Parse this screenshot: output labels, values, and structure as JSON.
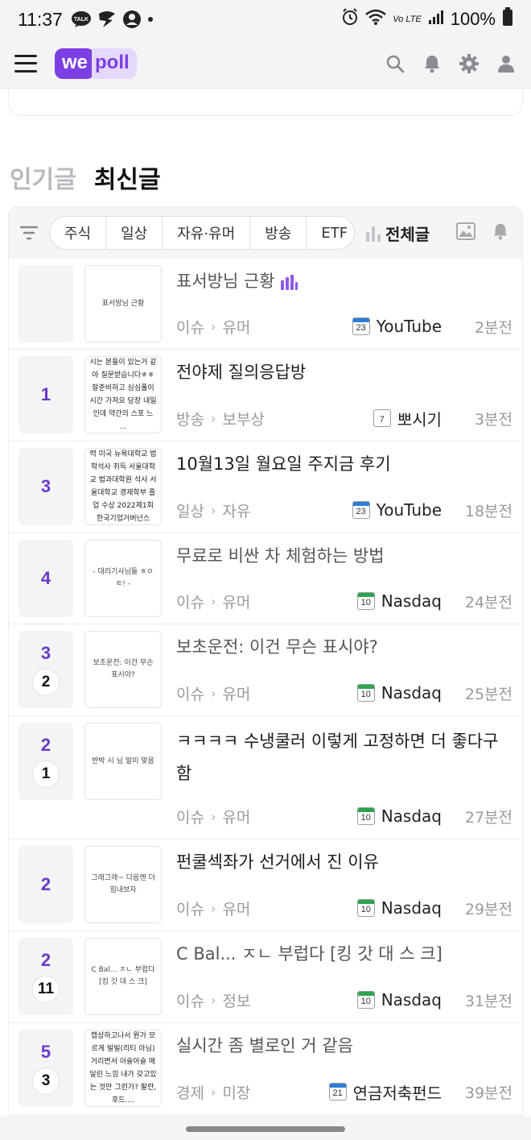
{
  "status_bar": {
    "time": "11:37",
    "battery": "100%",
    "network": "Vo LTE"
  },
  "header": {
    "logo_we": "we",
    "logo_poll": "poll"
  },
  "section_tabs": {
    "popular": "인기글",
    "latest": "최신글"
  },
  "filter_bar": {
    "chips": [
      "주식",
      "일상",
      "자유·유머",
      "방송",
      "ETF"
    ],
    "all_posts": "전체글"
  },
  "posts": [
    {
      "votes": "",
      "comments": "",
      "thumb": "표서방님 근황",
      "title": "표서방님 근황",
      "poll": true,
      "category": "이슈",
      "subcategory": "유머",
      "cal_day": "23",
      "cal_color": "blue",
      "source": "YouTube",
      "time_ago": "2분전"
    },
    {
      "votes": "1",
      "comments": "",
      "thumb": "시는 분들이 있는거 같아 질문받습니다ㅎㅎ 잘준비하고 심심풀이 시간 가져요 당장 내일인데 약간의 스포 느 ...",
      "title": "전야제 질의응답방",
      "poll": false,
      "category": "방송",
      "subcategory": "보부상",
      "cal_day": "7",
      "cal_color": "none",
      "source": "뽀시기",
      "time_ago": "3분전"
    },
    {
      "votes": "3",
      "comments": "",
      "thumb": "력 미국 뉴욕대학교 법학석사 취득 서울대학교 법과대학원 석사 서울대학교 경제학부 졸업 수상 2022제1회 한국기업거버넌스",
      "title": "10월13일 월요일 주지금 후기",
      "poll": false,
      "category": "일상",
      "subcategory": "자유",
      "cal_day": "23",
      "cal_color": "blue",
      "source": "YouTube",
      "time_ago": "18분전"
    },
    {
      "votes": "4",
      "comments": "",
      "thumb": "- 대리기사님들 ㅎㅇ ㅌ! -",
      "title": "무료로 비싼 차 체험하는 방법",
      "poll": false,
      "category": "이슈",
      "subcategory": "유머",
      "cal_day": "10",
      "cal_color": "green",
      "source": "Nasdaq",
      "time_ago": "24분전"
    },
    {
      "votes": "3",
      "comments": "2",
      "thumb": "보초운전: 이건 무슨 표시야?",
      "title": "보초운전: 이건 무슨 표시야?",
      "poll": false,
      "category": "이슈",
      "subcategory": "유머",
      "cal_day": "10",
      "cal_color": "green",
      "source": "Nasdaq",
      "time_ago": "25분전"
    },
    {
      "votes": "2",
      "comments": "1",
      "thumb": "반박 시 님 말이 맞음",
      "title": "ㅋㅋㅋㅋ 수냉쿨러 이렇게 고정하면 더 좋다구함",
      "poll": false,
      "category": "이슈",
      "subcategory": "유머",
      "cal_day": "10",
      "cal_color": "green",
      "source": "Nasdaq",
      "time_ago": "27분전"
    },
    {
      "votes": "2",
      "comments": "",
      "thumb": "그래그래~ 다음엔 더 힘내보자",
      "title": "펀쿨섹좌가 선거에서 진 이유",
      "poll": false,
      "category": "이슈",
      "subcategory": "유머",
      "cal_day": "10",
      "cal_color": "green",
      "source": "Nasdaq",
      "time_ago": "29분전"
    },
    {
      "votes": "2",
      "comments": "11",
      "thumb": "C Bal... ㅈㄴ 부럽다 [킹 갓 대 스 크]",
      "title": "C Bal... ㅈㄴ 부럽다 [킹 갓 대 스 크]",
      "poll": false,
      "category": "이슈",
      "subcategory": "정보",
      "cal_day": "10",
      "cal_color": "green",
      "source": "Nasdaq",
      "time_ago": "31분전"
    },
    {
      "votes": "5",
      "comments": "3",
      "thumb": "캡상하고나서 뭔가 모르게 빌빌(리티 아님)거리면서 아슬아슬 매달린 느낌 내가 갖고있는 것만 그런가? 팔란, 후드....",
      "title": "실시간 좀 별로인 거 같음",
      "poll": false,
      "category": "경제",
      "subcategory": "미장",
      "cal_day": "21",
      "cal_color": "blue",
      "source": "연금저축펀드",
      "time_ago": "39분전"
    }
  ],
  "colors": {
    "brand": "#7b3fe4",
    "vote_number": "#6a3bc8"
  }
}
